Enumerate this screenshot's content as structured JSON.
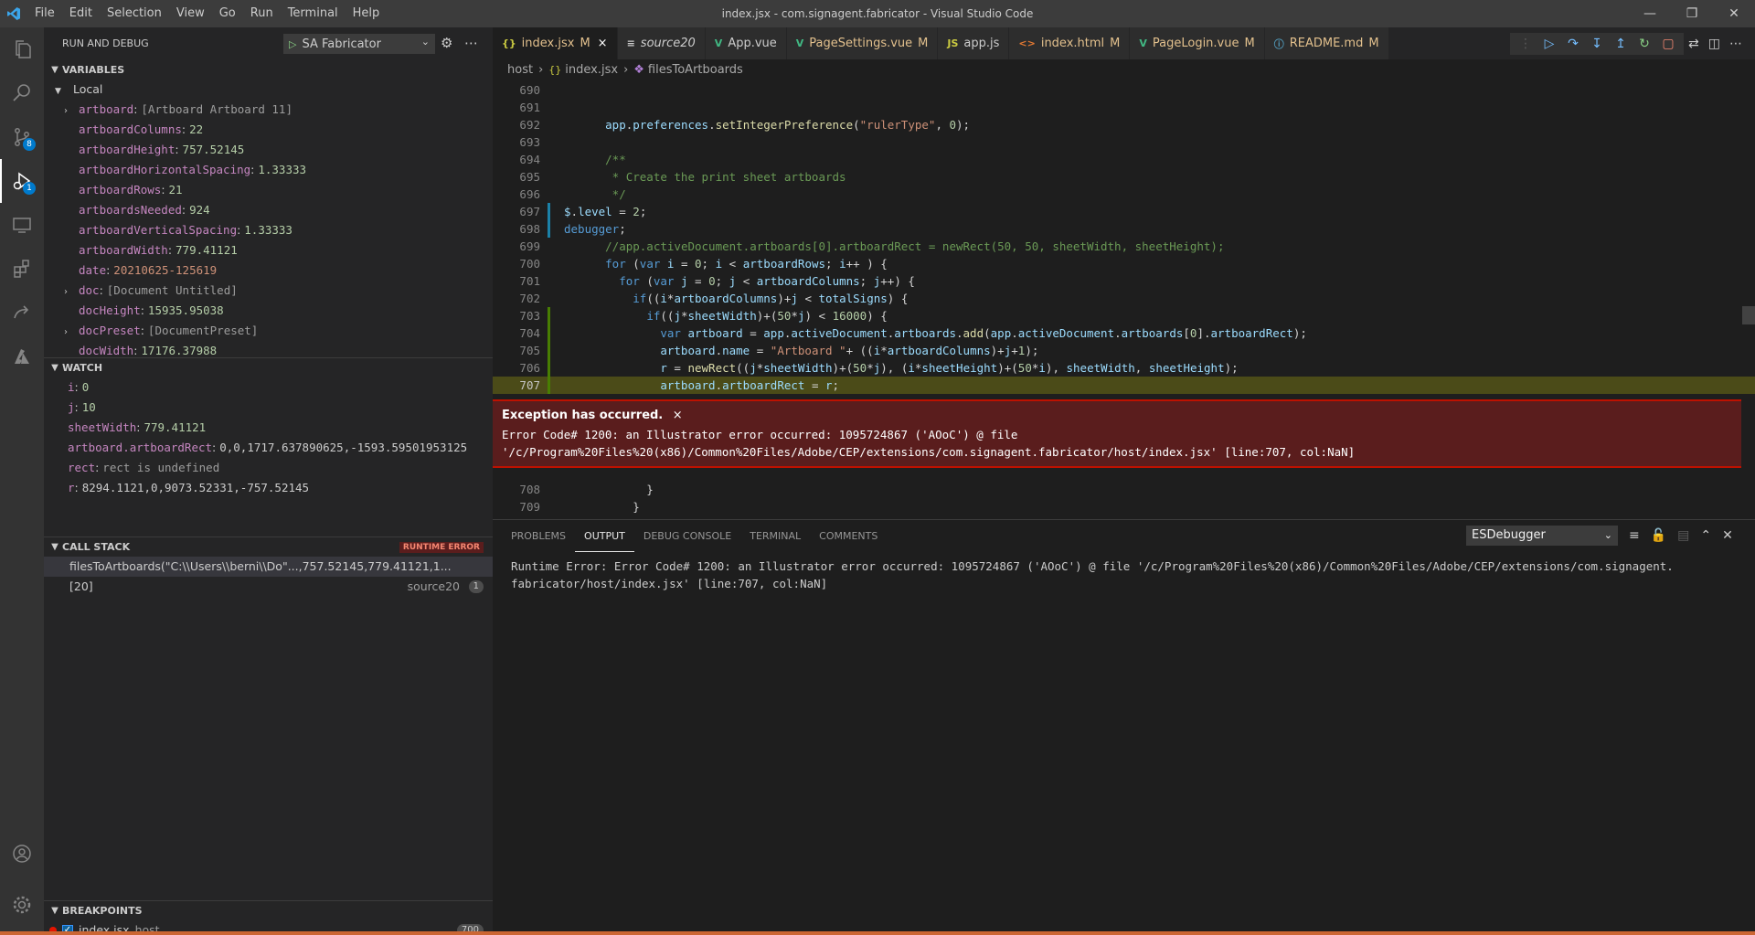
{
  "window": {
    "title": "index.jsx - com.signagent.fabricator - Visual Studio Code",
    "menu": [
      "File",
      "Edit",
      "Selection",
      "View",
      "Go",
      "Run",
      "Terminal",
      "Help"
    ]
  },
  "activity": {
    "scm_badge": "8",
    "debug_badge": "1"
  },
  "sidebar": {
    "title": "RUN AND DEBUG",
    "launch_config": "SA Fabricator",
    "variables_header": "VARIABLES",
    "local_header": "Local",
    "variables": [
      {
        "name": "artboard",
        "value": "[Artboard Artboard 11]",
        "kind": "obj",
        "expandable": true
      },
      {
        "name": "artboardColumns",
        "value": "22",
        "kind": "num"
      },
      {
        "name": "artboardHeight",
        "value": "757.52145",
        "kind": "num"
      },
      {
        "name": "artboardHorizontalSpacing",
        "value": "1.33333",
        "kind": "num"
      },
      {
        "name": "artboardRows",
        "value": "21",
        "kind": "num"
      },
      {
        "name": "artboardsNeeded",
        "value": "924",
        "kind": "num"
      },
      {
        "name": "artboardVerticalSpacing",
        "value": "1.33333",
        "kind": "num"
      },
      {
        "name": "artboardWidth",
        "value": "779.41121",
        "kind": "num"
      },
      {
        "name": "date",
        "value": "20210625-125619",
        "kind": "str"
      },
      {
        "name": "doc",
        "value": "[Document Untitled]",
        "kind": "obj",
        "expandable": true
      },
      {
        "name": "docHeight",
        "value": "15935.95038",
        "kind": "num"
      },
      {
        "name": "docPreset",
        "value": "[DocumentPreset]",
        "kind": "obj",
        "expandable": true
      },
      {
        "name": "docWidth",
        "value": "17176.37988",
        "kind": "num"
      }
    ],
    "watch_header": "WATCH",
    "watch": [
      {
        "name": "i",
        "value": "0",
        "kind": "num"
      },
      {
        "name": "j",
        "value": "10",
        "kind": "num"
      },
      {
        "name": "sheetWidth",
        "value": "779.41121",
        "kind": "num"
      },
      {
        "name": "artboard.artboardRect",
        "value": "0,0,1717.637890625,-1593.59501953125",
        "kind": "plain"
      },
      {
        "name": "rect",
        "value": "rect is undefined",
        "kind": "err"
      },
      {
        "name": "r",
        "value": "8294.1121,0,9073.52331,-757.52145",
        "kind": "plain"
      }
    ],
    "callstack_header": "CALL STACK",
    "callstack_badge": "RUNTIME ERROR",
    "callstack": [
      {
        "frame": "filesToArtboards(\"C:\\\\Users\\\\berni\\\\Do\"...,757.52145,779.41121,1...",
        "source": "",
        "count": ""
      },
      {
        "frame": "[20]",
        "source": "source20",
        "count": "1"
      }
    ],
    "breakpoints_header": "BREAKPOINTS",
    "breakpoint": {
      "file": "index.jsx",
      "folder": "host",
      "line": "700"
    }
  },
  "tabs": [
    {
      "label": "index.jsx",
      "mod": "M",
      "icon": "{}",
      "icon_color": "#cbcb41",
      "active": true,
      "close": "×"
    },
    {
      "label": "source20",
      "mod": "",
      "icon": "≡",
      "icon_color": "#cccccc",
      "italic": true
    },
    {
      "label": "App.vue",
      "mod": "",
      "icon": "V",
      "icon_color": "#41b883"
    },
    {
      "label": "PageSettings.vue",
      "mod": "M",
      "icon": "V",
      "icon_color": "#41b883"
    },
    {
      "label": "app.js",
      "mod": "",
      "icon": "JS",
      "icon_color": "#cbcb41"
    },
    {
      "label": "index.html",
      "mod": "M",
      "icon": "<>",
      "icon_color": "#e37933"
    },
    {
      "label": "PageLogin.vue",
      "mod": "M",
      "icon": "V",
      "icon_color": "#41b883"
    },
    {
      "label": "README.md",
      "mod": "M",
      "icon": "ⓘ",
      "icon_color": "#519aba"
    }
  ],
  "breadcrumb": [
    "host",
    "index.jsx",
    "filesToArtboards"
  ],
  "code": {
    "lines": [
      {
        "n": "690",
        "html": ""
      },
      {
        "n": "691",
        "html": ""
      },
      {
        "n": "692",
        "html": "      <span class='v'>app</span>.<span class='v'>preferences</span>.<span class='f'>setIntegerPreference</span>(<span class='s'>\"rulerType\"</span>, <span class='n'>0</span>);"
      },
      {
        "n": "693",
        "html": ""
      },
      {
        "n": "694",
        "html": "      <span class='c'>/**</span>"
      },
      {
        "n": "695",
        "html": "<span class='c'>       * Create the print sheet artboards</span>"
      },
      {
        "n": "696",
        "html": "<span class='c'>       */</span>"
      },
      {
        "n": "697",
        "html": "<span class='v'>$</span>.<span class='v'>level</span> = <span class='n'>2</span>;",
        "mod": "#1b81a8"
      },
      {
        "n": "698",
        "html": "<span class='k'>debugger</span>;",
        "mod": "#1b81a8"
      },
      {
        "n": "699",
        "html": "      <span class='c'>//app.activeDocument.artboards[0].artboardRect = newRect(50, 50, sheetWidth, sheetHeight);</span>"
      },
      {
        "n": "700",
        "html": "      <span class='k'>for</span> (<span class='k'>var</span> <span class='v'>i</span> = <span class='n'>0</span>; <span class='v'>i</span> &lt; <span class='v'>artboardRows</span>; <span class='v'>i</span>++ ) {",
        "bp": true
      },
      {
        "n": "701",
        "html": "        <span class='k'>for</span> (<span class='k'>var</span> <span class='v'>j</span> = <span class='n'>0</span>; <span class='v'>j</span> &lt; <span class='v'>artboardColumns</span>; <span class='v'>j</span>++) {"
      },
      {
        "n": "702",
        "html": "          <span class='k'>if</span>((<span class='v'>i</span>*<span class='v'>artboardColumns</span>)+<span class='v'>j</span> &lt; <span class='v'>totalSigns</span>) {"
      },
      {
        "n": "703",
        "html": "            <span class='k'>if</span>((<span class='v'>j</span>*<span class='v'>sheetWidth</span>)+(<span class='n'>50</span>*<span class='v'>j</span>) &lt; <span class='n'>16000</span>) {",
        "mod": "#487e02"
      },
      {
        "n": "704",
        "html": "              <span class='k'>var</span> <span class='v'>artboard</span> = <span class='v'>app</span>.<span class='v'>activeDocument</span>.<span class='v'>artboards</span>.<span class='f'>add</span>(<span class='v'>app</span>.<span class='v'>activeDocument</span>.<span class='v'>artboards</span>[<span class='n'>0</span>].<span class='v'>artboardRect</span>);",
        "mod": "#487e02"
      },
      {
        "n": "705",
        "html": "              <span class='v'>artboard</span>.<span class='v'>name</span> = <span class='s'>\"Artboard \"</span>+ ((<span class='v'>i</span>*<span class='v'>artboardColumns</span>)+<span class='v'>j</span>+<span class='n'>1</span>);",
        "mod": "#487e02"
      },
      {
        "n": "706",
        "html": "              <span class='v'>r</span> = <span class='f'>newRect</span>((<span class='v'>j</span>*<span class='v'>sheetWidth</span>)+(<span class='n'>50</span>*<span class='v'>j</span>), (<span class='v'>i</span>*<span class='v'>sheetHeight</span>)+(<span class='n'>50</span>*<span class='v'>i</span>), <span class='v'>sheetWidth</span>, <span class='v'>sheetHeight</span>);",
        "mod": "#487e02"
      },
      {
        "n": "707",
        "html": "              <span class='v'>artboard</span>.<span class='v'>artboardRect</span> = <span class='v'>r</span>;",
        "current": true,
        "mod": "#487e02"
      }
    ],
    "lines_after": [
      {
        "n": "708",
        "html": "            }"
      },
      {
        "n": "709",
        "html": "          }"
      }
    ]
  },
  "exception": {
    "title": "Exception has occurred.",
    "close": "×",
    "line1": "Error Code# 1200: an Illustrator error occurred: 1095724867 ('AOoC') @ file",
    "line2": "'/c/Program%20Files%20(x86)/Common%20Files/Adobe/CEP/extensions/com.signagent.fabricator/host/index.jsx' [line:707, col:NaN]"
  },
  "panel": {
    "tabs": [
      "PROBLEMS",
      "OUTPUT",
      "DEBUG CONSOLE",
      "TERMINAL",
      "COMMENTS"
    ],
    "active_tab": "OUTPUT",
    "output_channel": "ESDebugger",
    "output_text": "Runtime Error: Error Code# 1200: an Illustrator error occurred: 1095724867 ('AOoC') @ file '/c/Program%20Files%20(x86)/Common%20Files/Adobe/CEP/extensions/com.signagent.\nfabricator/host/index.jsx' [line:707, col:NaN]"
  }
}
